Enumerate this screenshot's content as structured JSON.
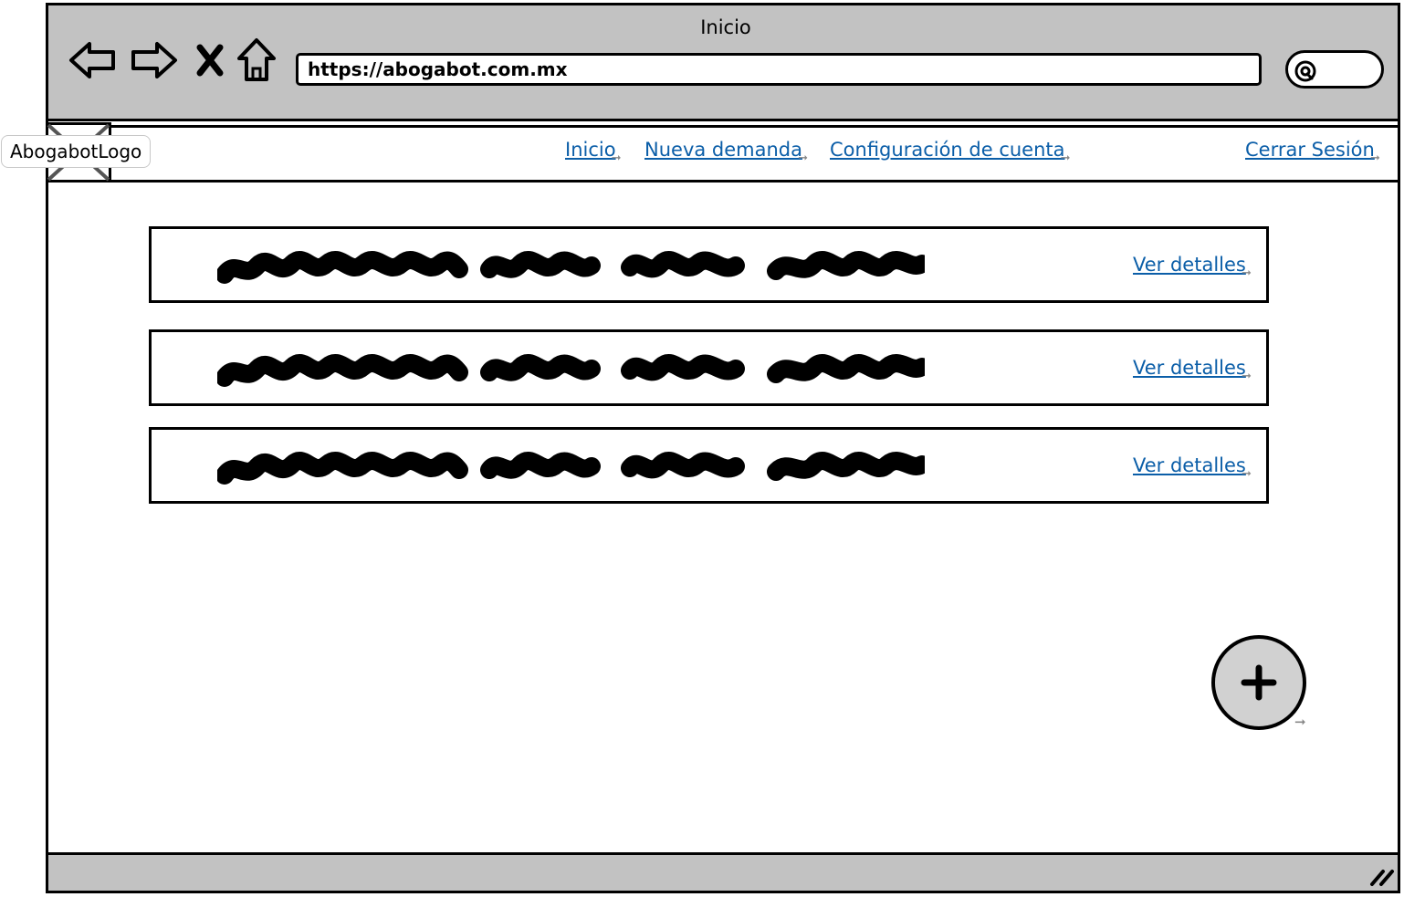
{
  "browser": {
    "title": "Inicio",
    "url": "https://abogabot.com.mx"
  },
  "header": {
    "logo": "AbogabotLogo",
    "nav": [
      {
        "label": "Inicio"
      },
      {
        "label": "Nueva demanda"
      },
      {
        "label": "Configuración de cuenta"
      }
    ],
    "logout": "Cerrar Sesión"
  },
  "cases": [
    {
      "action": "Ver detalles"
    },
    {
      "action": "Ver detalles"
    },
    {
      "action": "Ver detalles"
    }
  ],
  "fab": {
    "symbol": "+",
    "icon": "plus-icon"
  },
  "colors": {
    "chrome": "#c2c2c2",
    "link": "#0b5ea8",
    "fab": "#d1d1d1"
  }
}
